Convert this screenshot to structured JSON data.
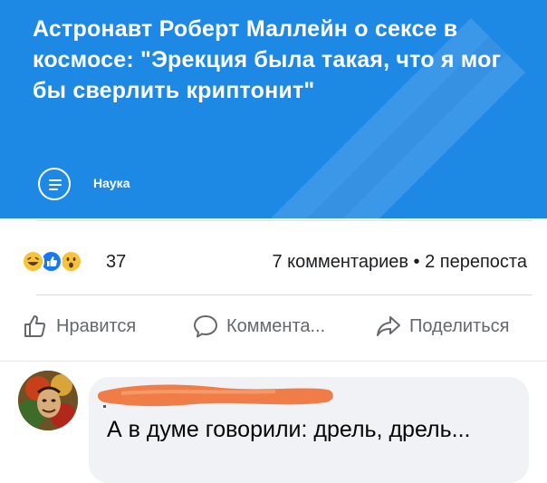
{
  "article": {
    "title": "Астронавт Роберт Маллейн о сексе в космосе: \"Эрекция была такая, что я мог бы сверлить криптонит\"",
    "category": "Наука",
    "category_icon": "menu-lines-icon",
    "background_color": "#1e88e5"
  },
  "reactions": {
    "icons": [
      "laugh-emoji-icon",
      "like-emoji-icon",
      "wow-emoji-icon"
    ],
    "count": "37",
    "stats": "7 комментариев • 2 перепоста"
  },
  "actions": {
    "like_label": "Нравится",
    "comment_label": "Коммента...",
    "share_label": "Поделиться"
  },
  "comment": {
    "author_redacted": true,
    "text": "А в думе говорили: дрель, дрель..."
  }
}
